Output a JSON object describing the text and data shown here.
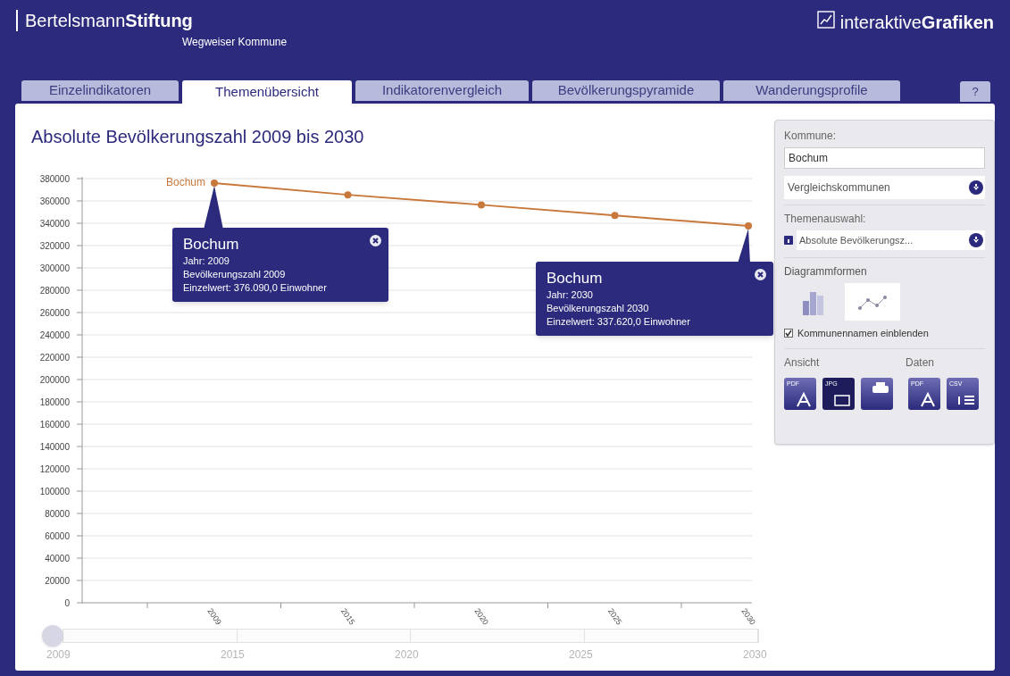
{
  "header": {
    "logo": "Bertelsmann**Stiftung**",
    "subtitle": "Wegweiser Kommune",
    "brand": "interaktive**Grafiken**"
  },
  "tabs": [
    {
      "label": "Einzelindikatoren",
      "selected": false
    },
    {
      "label": "Themenübersicht",
      "selected": true
    },
    {
      "label": "Indikatorenvergleich",
      "selected": false
    },
    {
      "label": "Bevölkerungspyramide",
      "selected": false
    },
    {
      "label": "Wanderungsprofile",
      "selected": false
    }
  ],
  "help_button": "?",
  "chart": {
    "title": "Absolute Bevölkerungszahl 2009 bis 2030",
    "chart_data": {
      "type": "line",
      "categories": [
        "2009",
        "2015",
        "2020",
        "2025",
        "2030"
      ],
      "series": [
        {
          "name": "Bochum",
          "color": "#c8783a",
          "marker": "circle",
          "values": [
            376000,
            365500,
            356500,
            347000,
            337600
          ]
        }
      ],
      "grid": true,
      "ylim": [
        0,
        380000
      ],
      "yticks": [
        0,
        20000,
        40000,
        60000,
        80000,
        100000,
        120000,
        140000,
        160000,
        180000,
        200000,
        220000,
        240000,
        260000,
        280000,
        300000,
        320000,
        340000,
        360000,
        380000
      ]
    },
    "tooltips": [
      {
        "title": "Bochum",
        "lines": [
          "Jahr: 2009",
          "Bevölkerungszahl 2009",
          "Einzelwert: 376.090,0 Einwohner"
        ]
      },
      {
        "title": "Bochum",
        "lines": [
          "Jahr: 2030",
          "Bevölkerungszahl 2030",
          "Einzelwert: 337.620,0 Einwohner"
        ]
      }
    ]
  },
  "time_slider": {
    "level": 0,
    "labels": [
      "2009",
      "2015",
      "2020",
      "2025",
      "2030"
    ]
  },
  "sidebar": {
    "kommune_label": "Kommune:",
    "kommune_value": "Bochum",
    "compare_dropdown": "Vergleichskommunen",
    "topic_label": "Themenauswahl:",
    "topic_dropdown": "Absolute Bevölkerungsz...",
    "chart_types_label": "Diagrammformen",
    "chart_types": [
      {
        "kind": "bar",
        "selected": false
      },
      {
        "kind": "line",
        "selected": true
      }
    ],
    "show_names": {
      "label": "Kommunennamen einblenden",
      "checked": true
    },
    "view_label": "Ansicht",
    "data_label": "Daten",
    "view_buttons": [
      {
        "kind": "pdf",
        "label": "PDF",
        "selected": false
      },
      {
        "kind": "jpg",
        "label": "JPG",
        "selected": true
      },
      {
        "kind": "print",
        "selected": false
      }
    ],
    "data_buttons": [
      {
        "kind": "pdf",
        "label": "PDF",
        "selected": false
      },
      {
        "kind": "csv",
        "label": "CSV",
        "selected": false
      }
    ]
  }
}
